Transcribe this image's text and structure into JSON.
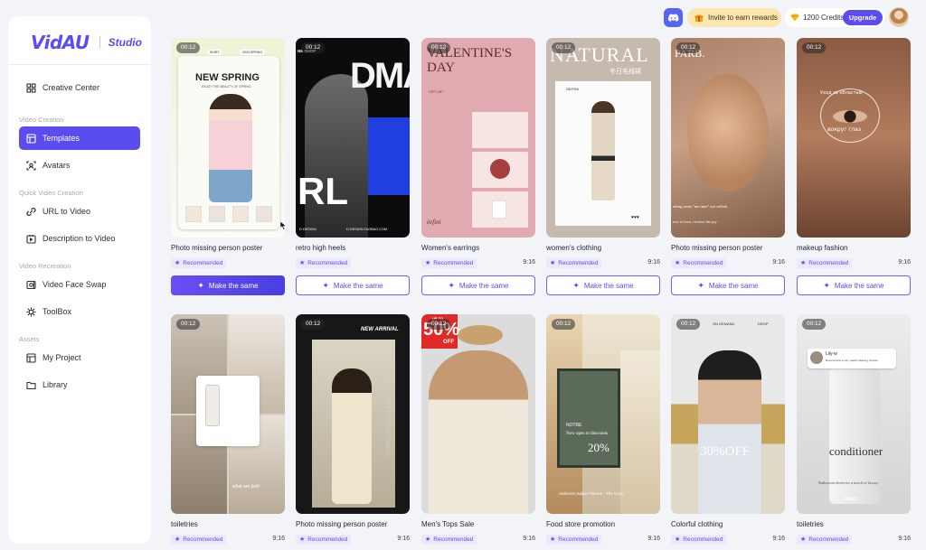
{
  "app": {
    "logo": "VidAU",
    "logo_sub": "Studio"
  },
  "sidebar": {
    "items": [
      {
        "label": "Creative Center",
        "icon": "grid-icon"
      },
      {
        "section": "Video Creation"
      },
      {
        "label": "Templates",
        "icon": "template-icon",
        "active": true
      },
      {
        "label": "Avatars",
        "icon": "avatar-icon"
      },
      {
        "section": "Quick Video Creation"
      },
      {
        "label": "URL to Video",
        "icon": "link-icon"
      },
      {
        "label": "Description to Video",
        "icon": "description-icon"
      },
      {
        "section": "Video Recreation"
      },
      {
        "label": "Video Face Swap",
        "icon": "face-swap-icon"
      },
      {
        "label": "ToolBox",
        "icon": "toolbox-icon"
      },
      {
        "section": "Assets"
      },
      {
        "label": "My Project",
        "icon": "project-icon"
      },
      {
        "label": "Library",
        "icon": "folder-icon"
      }
    ]
  },
  "topbar": {
    "invite_label": "Invite to earn rewards",
    "credits_label": "1200 Credits",
    "upgrade_label": "Upgrade",
    "accent": "#5b4cf0"
  },
  "common": {
    "recommended": "Recommended",
    "make_same": "Make the same",
    "ratio": "9:16"
  },
  "row1": [
    {
      "duration": "00:12",
      "title": "Photo missing person poster",
      "overlay": [
        "SHIRT",
        "2023 SPRING",
        "NEW SPRING",
        "ENJOY THE BEAUTY OF SPRING"
      ]
    },
    {
      "duration": "00:12",
      "title": "retro high heels",
      "overlay": [
        "NE SHOP",
        "DMA",
        "RL",
        "D·DESIGN",
        "D·DESIGN.TAOBAO.COM"
      ]
    },
    {
      "duration": "00:12",
      "title": "Women's earrings",
      "ratio": "9:16",
      "overlay": [
        "VALENTINE'S",
        "DAY",
        "GIFT LIST",
        "èefini"
      ]
    },
    {
      "duration": "00:12",
      "title": "women's clothing",
      "ratio": "9:16",
      "overlay": [
        "NATURAL",
        "冬日毛线裙",
        "SEIFINI"
      ]
    },
    {
      "duration": "00:12",
      "title": "Photo missing person poster",
      "ratio": "9:16",
      "overlay": [
        "PARB.",
        "etting some \"me time\" not selfish",
        "ove to love, receive the joy"
      ]
    },
    {
      "duration": "00:12",
      "title": "makeup fashion",
      "ratio": "9:16",
      "overlay": [
        "Уход за областью",
        "вокруг глаз"
      ]
    }
  ],
  "row2": [
    {
      "duration": "00:12",
      "title": "toiletries",
      "ratio": "9:16",
      "overlay": [
        "what are both"
      ]
    },
    {
      "duration": "00:12",
      "title": "Photo missing person poster",
      "ratio": "9:16",
      "overlay": [
        "NEW ARRIVAL",
        "THE ESSENTIAL LOOK FOR DAILY WEAR"
      ]
    },
    {
      "duration": "00:12",
      "title": "Men's Tops Sale",
      "ratio": "9:16",
      "overlay": [
        "UP TO",
        "50%",
        "OFF"
      ]
    },
    {
      "duration": "00:12",
      "title": "Food store promotion",
      "ratio": "9:16",
      "overlay": [
        "NOTRE",
        "Now open to discounts",
        "20%",
        "Authentic Italian Flavors - The Cozy"
      ]
    },
    {
      "duration": "00:12",
      "title": "Colorful clothing",
      "ratio": "9:16",
      "overlay": [
        "ON DEMAND",
        "DROP",
        "30%OFF"
      ]
    },
    {
      "duration": "00:12",
      "title": "toiletries",
      "ratio": "9:16",
      "overlay": [
        "Lily-w",
        "Recommend a very useful cleaning product",
        "conditioner",
        "Bathroom deserves a touch of luxury",
        "VidAU"
      ]
    }
  ]
}
